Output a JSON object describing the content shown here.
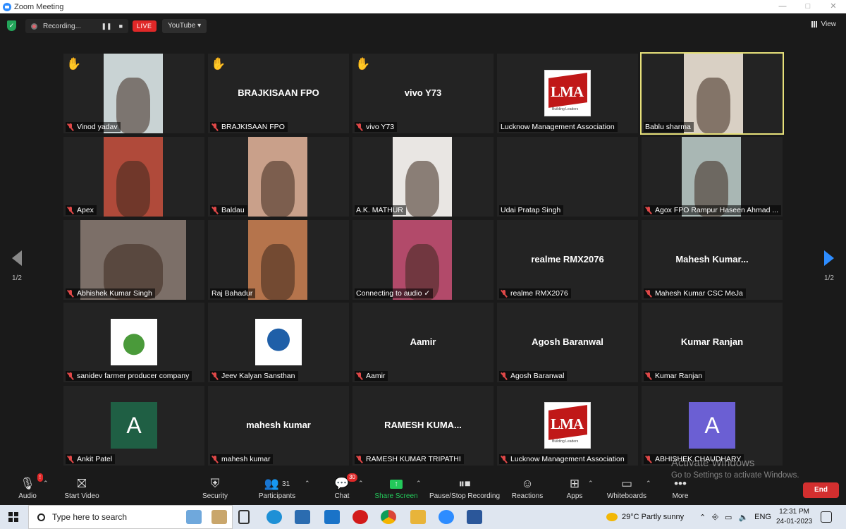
{
  "window": {
    "title": "Zoom Meeting",
    "controls": [
      "—",
      "□",
      "✕"
    ]
  },
  "topbar": {
    "recording_label": "Recording...",
    "live_label": "LIVE",
    "stream_target": "YouTube",
    "view_label": "View"
  },
  "pagination": {
    "left": "1/2",
    "right": "1/2"
  },
  "tiles": [
    {
      "name": "Vinod yadav",
      "center": "",
      "hand": true,
      "muted": true
    },
    {
      "name": "BRAJKISAAN FPO",
      "center": "BRAJKISAAN FPO",
      "hand": true,
      "muted": true
    },
    {
      "name": "vivo Y73",
      "center": "vivo Y73",
      "hand": true,
      "muted": true
    },
    {
      "name": "Lucknow Management Association",
      "center": "",
      "hand": false,
      "muted": false
    },
    {
      "name": "Bablu sharma",
      "center": "",
      "hand": false,
      "muted": false,
      "active": true
    },
    {
      "name": "Apex",
      "center": "",
      "hand": false,
      "muted": true
    },
    {
      "name": "Baldau",
      "center": "",
      "hand": false,
      "muted": true
    },
    {
      "name": "A.K. MATHUR",
      "center": "",
      "hand": false,
      "muted": false
    },
    {
      "name": "Udai Pratap Singh",
      "center": "",
      "hand": false,
      "muted": false
    },
    {
      "name": "Agox FPO Rampur Haseen Ahmad ...",
      "center": "",
      "hand": false,
      "muted": true
    },
    {
      "name": "Abhishek Kumar Singh",
      "center": "",
      "hand": false,
      "muted": true
    },
    {
      "name": "Raj Bahadur",
      "center": "",
      "hand": false,
      "muted": false
    },
    {
      "name": "Connecting to audio ✓",
      "center": "",
      "hand": false,
      "muted": false
    },
    {
      "name": "realme RMX2076",
      "center": "realme RMX2076",
      "hand": false,
      "muted": true
    },
    {
      "name": "Mahesh Kumar CSC MeJa",
      "center": "Mahesh  Kumar...",
      "hand": false,
      "muted": true
    },
    {
      "name": "sanidev farmer producer company",
      "center": "",
      "hand": false,
      "muted": true
    },
    {
      "name": "Jeev Kalyan Sansthan",
      "center": "",
      "hand": false,
      "muted": true
    },
    {
      "name": "Aamir",
      "center": "Aamir",
      "hand": false,
      "muted": true
    },
    {
      "name": "Agosh Baranwal",
      "center": "Agosh Baranwal",
      "hand": false,
      "muted": true
    },
    {
      "name": "Kumar Ranjan",
      "center": "Kumar Ranjan",
      "hand": false,
      "muted": true
    },
    {
      "name": "Ankit Patel",
      "center": "",
      "hand": false,
      "muted": true,
      "avatar": "A"
    },
    {
      "name": "mahesh kumar",
      "center": "mahesh kumar",
      "hand": false,
      "muted": true
    },
    {
      "name": "RAMESH KUMAR TRIPATHI",
      "center": "RAMESH  KUMA...",
      "hand": false,
      "muted": true
    },
    {
      "name": "Lucknow Management Association",
      "center": "",
      "hand": false,
      "muted": true
    },
    {
      "name": "ABHISHEK CHAUDHARY",
      "center": "",
      "hand": false,
      "muted": true,
      "avatar": "A"
    }
  ],
  "logos": {
    "lma_text": "LMA",
    "lma_sub": "Building Leaders"
  },
  "toolbar": {
    "audio": "Audio",
    "start_video": "Start Video",
    "security": "Security",
    "participants": "Participants",
    "participants_count": "31",
    "chat": "Chat",
    "chat_badge": "30",
    "share": "Share Screen",
    "pause_stop": "Pause/Stop Recording",
    "reactions": "Reactions",
    "apps": "Apps",
    "whiteboards": "Whiteboards",
    "more": "More",
    "end": "End",
    "audio_badge": "!"
  },
  "watermark": {
    "line1": "Activate Windows",
    "line2": "Go to Settings to activate Windows."
  },
  "taskbar": {
    "search_placeholder": "Type here to search",
    "weather": "29°C  Partly sunny",
    "lang": "ENG",
    "time": "12:31 PM",
    "date": "24-01-2023"
  },
  "colors": {
    "accent_green": "#23a55a",
    "live_red": "#e02828",
    "active_border": "#e6e07a",
    "avatar_green": "#1f5f44",
    "avatar_purple": "#6b5fd3"
  }
}
